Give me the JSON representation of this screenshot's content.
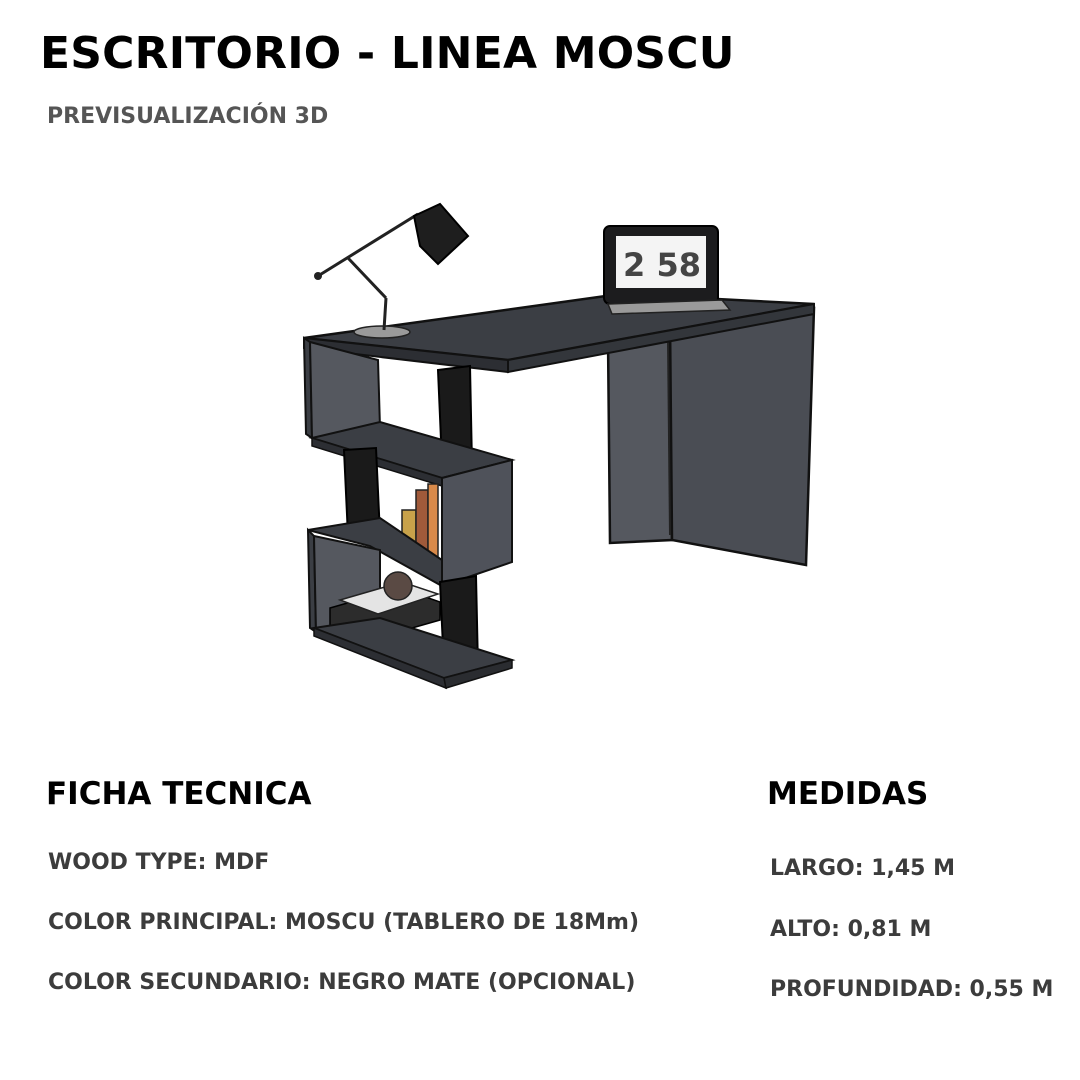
{
  "header": {
    "title": "ESCRITORIO - LINEA MOSCU",
    "subtitle": "PREVISUALIZACIÓN 3D"
  },
  "preview": {
    "laptop_clock": "2 58"
  },
  "ficha": {
    "heading": "FICHA TECNICA",
    "items": [
      "WOOD TYPE: MDF",
      "COLOR PRINCIPAL: MOSCU (TABLERO DE 18Mm)",
      "COLOR SECUNDARIO: NEGRO MATE (OPCIONAL)"
    ]
  },
  "medidas": {
    "heading": "MEDIDAS",
    "items": [
      "LARGO: 1,45 M",
      "ALTO: 0,81 M",
      "PROFUNDIDAD: 0,55 M"
    ]
  },
  "colors": {
    "panel": "#3b3e44",
    "panel_dark": "#2a2c30",
    "black": "#1a1a1a"
  }
}
